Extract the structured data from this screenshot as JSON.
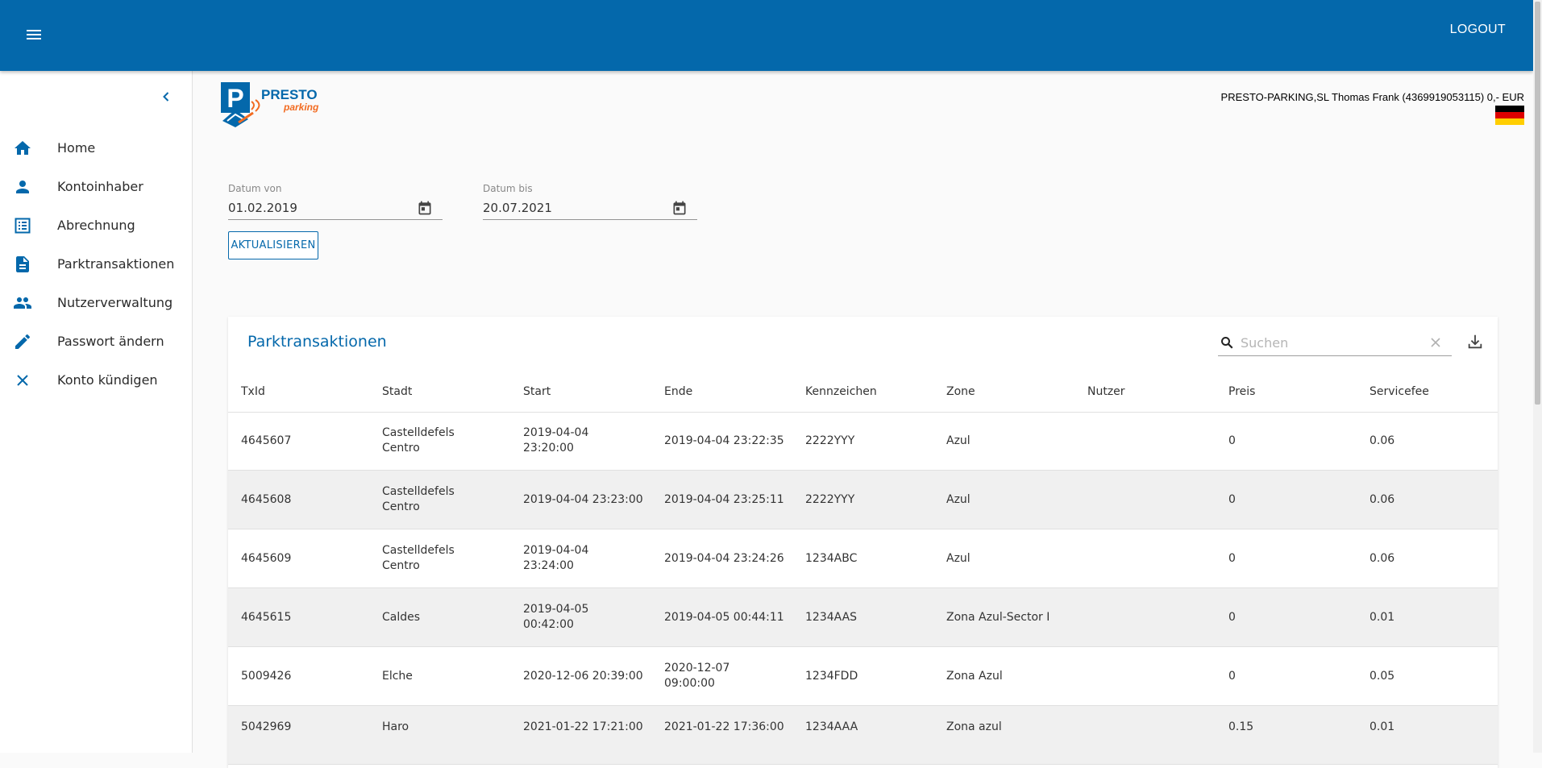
{
  "header": {
    "logout_label": "LOGOUT"
  },
  "sidebar": {
    "items": [
      {
        "label": "Home",
        "icon": "home-icon"
      },
      {
        "label": "Kontoinhaber",
        "icon": "person-icon"
      },
      {
        "label": "Abrechnung",
        "icon": "list-icon"
      },
      {
        "label": "Parktransaktionen",
        "icon": "document-icon"
      },
      {
        "label": "Nutzerverwaltung",
        "icon": "people-icon"
      },
      {
        "label": "Passwort ändern",
        "icon": "pencil-icon"
      },
      {
        "label": "Konto kündigen",
        "icon": "close-icon"
      }
    ]
  },
  "brand": {
    "logo_text_1": "PRESTO",
    "logo_text_2": "parking",
    "logo_letter": "P"
  },
  "account": {
    "info": "PRESTO-PARKING,SL Thomas Frank (4369919053115) 0,- EUR",
    "language_flag": "de"
  },
  "filters": {
    "date_from_label": "Datum von",
    "date_from_value": "01.02.2019",
    "date_to_label": "Datum bis",
    "date_to_value": "20.07.2021",
    "refresh_label": "AKTUALISIEREN"
  },
  "table": {
    "title": "Parktransaktionen",
    "search_placeholder": "Suchen",
    "columns": [
      "TxId",
      "Stadt",
      "Start",
      "Ende",
      "Kennzeichen",
      "Zone",
      "Nutzer",
      "Preis",
      "Servicefee"
    ],
    "rows": [
      [
        "4645607",
        "Castelldefels Centro",
        "2019-04-04 23:20:00",
        "2019-04-04 23:22:35",
        "2222YYY",
        "Azul",
        "",
        "0",
        "0.06"
      ],
      [
        "4645608",
        "Castelldefels Centro",
        "2019-04-04 23:23:00",
        "2019-04-04 23:25:11",
        "2222YYY",
        "Azul",
        "",
        "0",
        "0.06"
      ],
      [
        "4645609",
        "Castelldefels Centro",
        "2019-04-04 23:24:00",
        "2019-04-04 23:24:26",
        "1234ABC",
        "Azul",
        "",
        "0",
        "0.06"
      ],
      [
        "4645615",
        "Caldes",
        "2019-04-05 00:42:00",
        "2019-04-05 00:44:11",
        "1234AAS",
        "Zona Azul-Sector I",
        "",
        "0",
        "0.01"
      ],
      [
        "5009426",
        "Elche",
        "2020-12-06 20:39:00",
        "2020-12-07 09:00:00",
        "1234FDD",
        "Zona Azul",
        "",
        "0",
        "0.05"
      ],
      [
        "5042969",
        "Haro",
        "2021-01-22 17:21:00",
        "2021-01-22 17:36:00",
        "1234AAA",
        "Zona azul",
        "",
        "0.15",
        "0.01"
      ]
    ]
  },
  "colors": {
    "primary": "#0468ab",
    "accent_orange": "#f26b21"
  }
}
